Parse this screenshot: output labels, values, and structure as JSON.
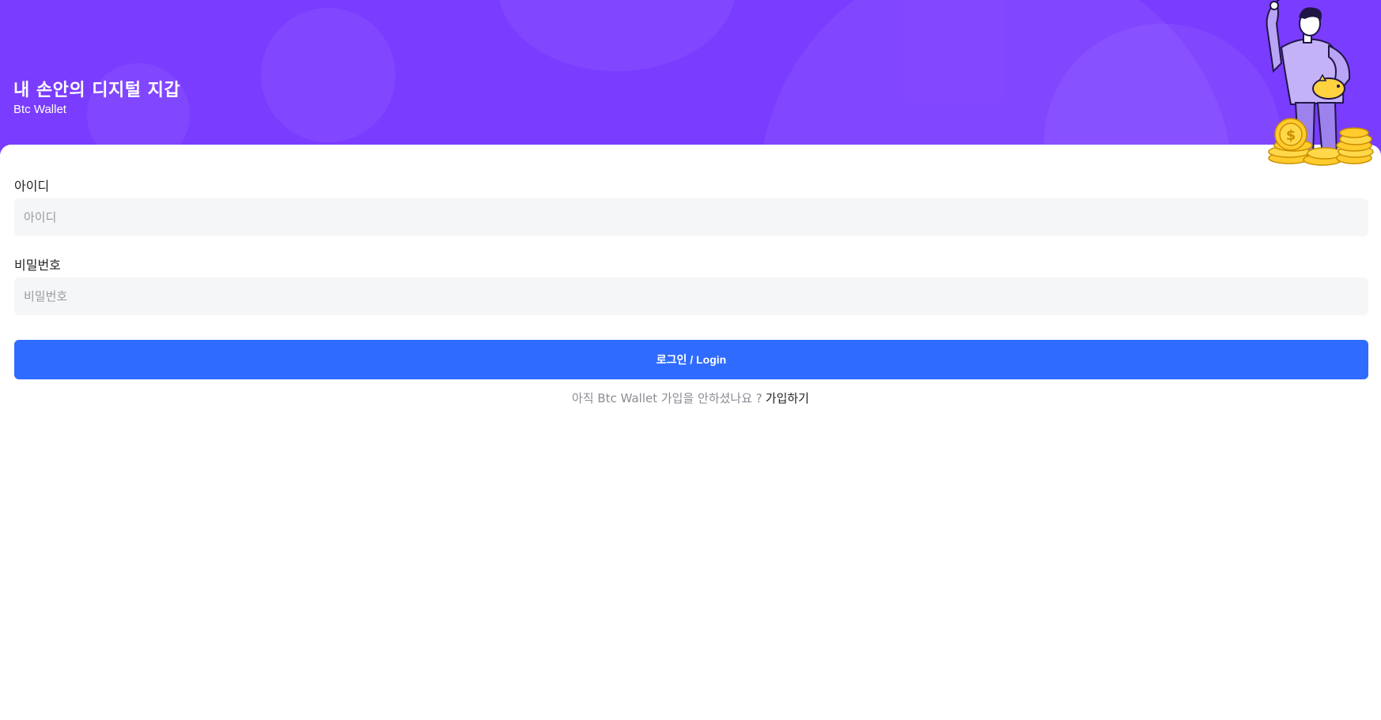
{
  "header": {
    "title": "내 손안의 디지털 지갑",
    "subtitle": "Btc Wallet",
    "background_color": "#7a3cff"
  },
  "form": {
    "id_label": "아이디",
    "id_placeholder": "아이디",
    "password_label": "비밀번호",
    "password_placeholder": "비밀번호",
    "login_button_label": "로그인 / Login",
    "login_button_color": "#2f6bff"
  },
  "signup": {
    "prompt": "아직 Btc Wallet 가입을 안하셨나요 ?",
    "link_label": "가입하기"
  },
  "illustration": {
    "icon": "man-with-coins-illustration"
  }
}
